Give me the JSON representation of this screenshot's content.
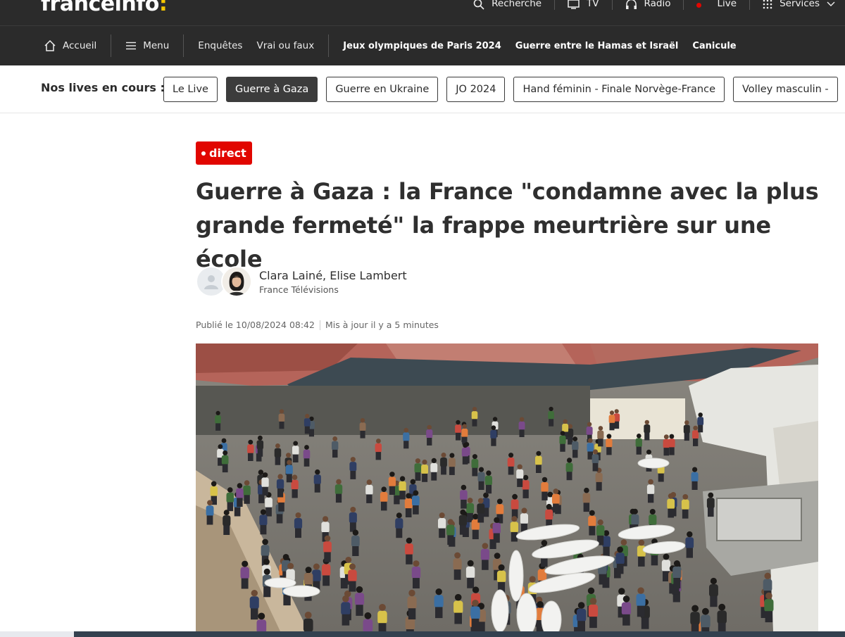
{
  "header": {
    "logo_text": "franceinfo",
    "logo_colon": ":",
    "top_nav": [
      {
        "label": "Recherche",
        "icon": "search-icon"
      },
      {
        "label": "TV",
        "icon": "tv-icon"
      },
      {
        "label": "Radio",
        "icon": "headphones-icon"
      },
      {
        "label": "Live",
        "icon": "live-dot-icon"
      },
      {
        "label": "Services",
        "icon": "grid-icon"
      }
    ]
  },
  "navbar": {
    "home_label": "Accueil",
    "menu_label": "Menu",
    "links": [
      "Enquêtes",
      "Vrai ou faux"
    ],
    "topics": [
      "Jeux olympiques de Paris 2024",
      "Guerre entre le Hamas et Israël",
      "Canicule"
    ]
  },
  "lives": {
    "title": "Nos lives en cours :",
    "chips": [
      "Le Live",
      "Guerre à Gaza",
      "Guerre en Ukraine",
      "JO 2024",
      "Hand féminin - Finale Norvège-France",
      "Volley masculin - "
    ],
    "active_index": 1
  },
  "article": {
    "badge": "direct",
    "headline": "Guerre à Gaza : la France \"condamne avec la plus grande fermeté\" la frappe meurtrière sur une école",
    "authors": "Clara Lainé, Elise Lambert",
    "organization": "France Télévisions",
    "published": "Publié le 10/08/2024 08:42",
    "updated": "Mis à jour il y a 5 minutes"
  },
  "colors": {
    "header_bg": "#2b2b2b",
    "accent_yellow": "#f6c700",
    "live_red": "#e10600",
    "text_dark": "#2f2f2f"
  }
}
